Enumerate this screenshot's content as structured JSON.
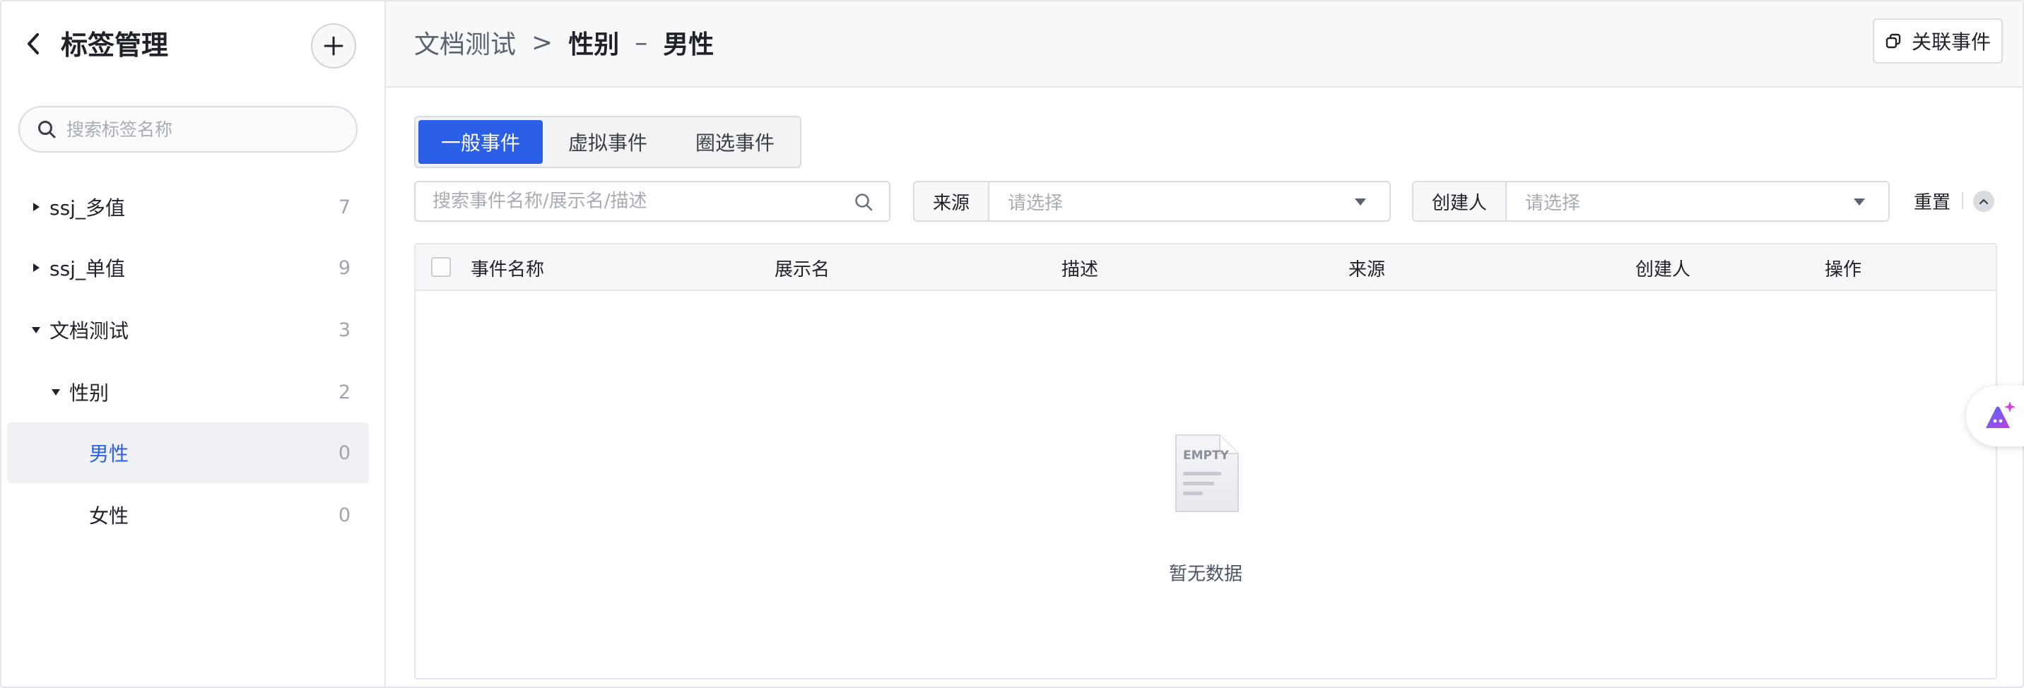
{
  "sidebar": {
    "title": "标签管理",
    "search_placeholder": "搜索标签名称",
    "items": [
      {
        "label": "ssj_多值",
        "count": "7"
      },
      {
        "label": "ssj_单值",
        "count": "9"
      },
      {
        "label": "文档测试",
        "count": "3"
      },
      {
        "label": "性别",
        "count": "2"
      },
      {
        "label": "男性",
        "count": "0"
      },
      {
        "label": "女性",
        "count": "0"
      }
    ]
  },
  "header": {
    "breadcrumb_parent": "文档测试",
    "breadcrumb_sep": ">",
    "breadcrumb_current": "性别",
    "breadcrumb_dash": "–",
    "breadcrumb_leaf": "男性",
    "link_button": "关联事件"
  },
  "tabs": [
    "一般事件",
    "虚拟事件",
    "圈选事件"
  ],
  "filters": {
    "search_placeholder": "搜索事件名称/展示名/描述",
    "source_label": "来源",
    "source_placeholder": "请选择",
    "creator_label": "创建人",
    "creator_placeholder": "请选择",
    "reset": "重置"
  },
  "table": {
    "columns": [
      "事件名称",
      "展示名",
      "描述",
      "来源",
      "创建人",
      "操作"
    ],
    "empty_icon_text": "EMPTY",
    "empty_text": "暂无数据"
  },
  "colors": {
    "accent": "#2b5fe8",
    "float_icon": "#7b3fe4"
  }
}
